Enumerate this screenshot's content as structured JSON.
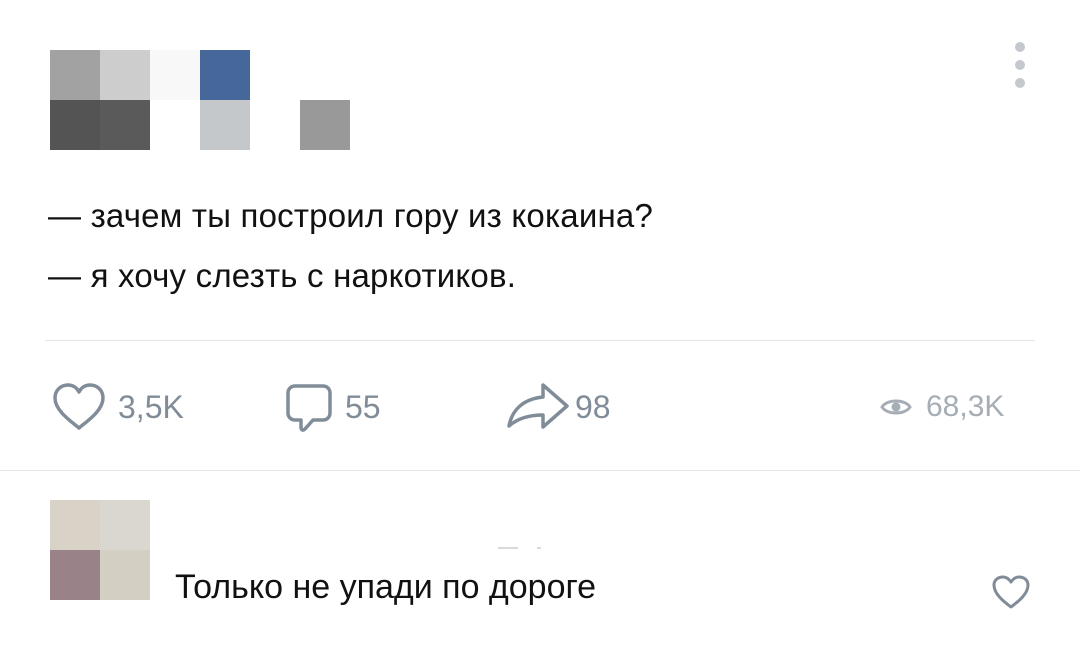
{
  "post": {
    "author_redacted": true,
    "lines": [
      "— зачем ты построил гору из кокаина?",
      "— я хочу слезть с наркотиков."
    ],
    "more_icon": "vertical-dots-icon"
  },
  "actions": {
    "likes": {
      "icon": "heart-outline-icon",
      "count": "3,5K"
    },
    "comments": {
      "icon": "comment-bubble-icon",
      "count": "55"
    },
    "shares": {
      "icon": "share-arrow-icon",
      "count": "98"
    },
    "views": {
      "icon": "eye-icon",
      "count": "68,3K"
    }
  },
  "comment": {
    "author_redacted": true,
    "text": "Только не упади по дороге",
    "like_icon": "heart-outline-icon"
  },
  "colors": {
    "icon_gray": "#818c99",
    "views_gray": "#a6adb5",
    "divider": "#e4e6ea",
    "text": "#111111",
    "avatar_blue_block": "#45679a"
  }
}
